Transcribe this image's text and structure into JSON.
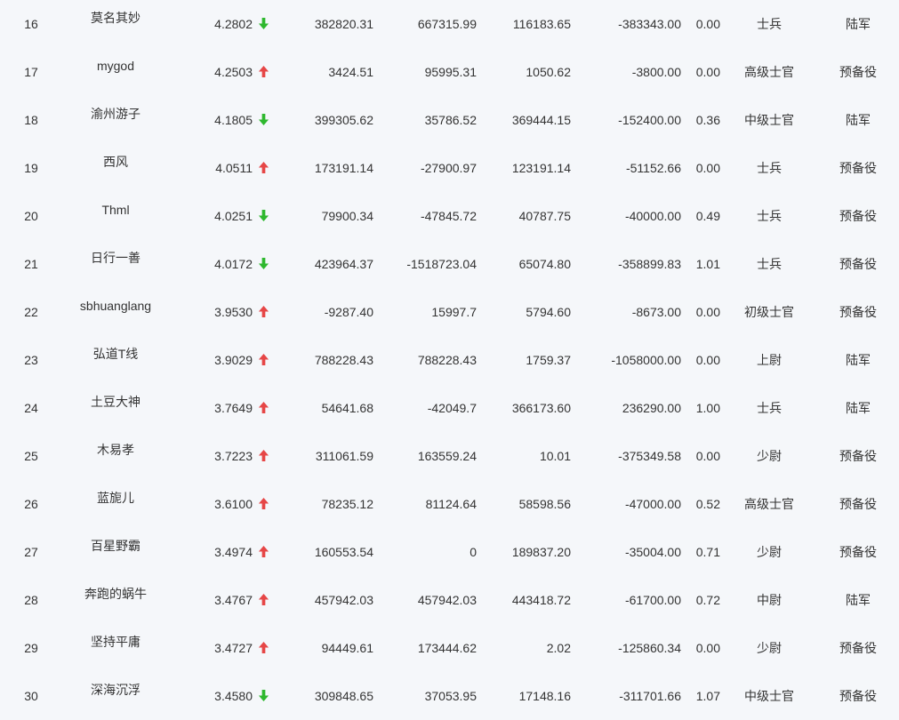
{
  "colors": {
    "background": "#f5f7fa",
    "text": "#333333",
    "up": "#e64646",
    "down": "#2eb82e"
  },
  "rows": [
    {
      "rank": "16",
      "name": "莫名其妙",
      "score": "4.2802",
      "trend": "down",
      "v1": "382820.31",
      "v2": "667315.99",
      "v3": "116183.65",
      "v4": "-383343.00",
      "v5": "0.00",
      "title": "士兵",
      "branch": "陆军"
    },
    {
      "rank": "17",
      "name": "mygod",
      "score": "4.2503",
      "trend": "up",
      "v1": "3424.51",
      "v2": "95995.31",
      "v3": "1050.62",
      "v4": "-3800.00",
      "v5": "0.00",
      "title": "高级士官",
      "branch": "预备役"
    },
    {
      "rank": "18",
      "name": "渝州游子",
      "score": "4.1805",
      "trend": "down",
      "v1": "399305.62",
      "v2": "35786.52",
      "v3": "369444.15",
      "v4": "-152400.00",
      "v5": "0.36",
      "title": "中级士官",
      "branch": "陆军"
    },
    {
      "rank": "19",
      "name": "西风",
      "score": "4.0511",
      "trend": "up",
      "v1": "173191.14",
      "v2": "-27900.97",
      "v3": "123191.14",
      "v4": "-51152.66",
      "v5": "0.00",
      "title": "士兵",
      "branch": "预备役"
    },
    {
      "rank": "20",
      "name": "Thml",
      "score": "4.0251",
      "trend": "down",
      "v1": "79900.34",
      "v2": "-47845.72",
      "v3": "40787.75",
      "v4": "-40000.00",
      "v5": "0.49",
      "title": "士兵",
      "branch": "预备役"
    },
    {
      "rank": "21",
      "name": "日行一善",
      "score": "4.0172",
      "trend": "down",
      "v1": "423964.37",
      "v2": "-1518723.04",
      "v3": "65074.80",
      "v4": "-358899.83",
      "v5": "1.01",
      "title": "士兵",
      "branch": "预备役"
    },
    {
      "rank": "22",
      "name": "sbhuanglang",
      "score": "3.9530",
      "trend": "up",
      "v1": "-9287.40",
      "v2": "15997.7",
      "v3": "5794.60",
      "v4": "-8673.00",
      "v5": "0.00",
      "title": "初级士官",
      "branch": "预备役"
    },
    {
      "rank": "23",
      "name": "弘道T线",
      "score": "3.9029",
      "trend": "up",
      "v1": "788228.43",
      "v2": "788228.43",
      "v3": "1759.37",
      "v4": "-1058000.00",
      "v5": "0.00",
      "title": "上尉",
      "branch": "陆军"
    },
    {
      "rank": "24",
      "name": "土豆大神",
      "score": "3.7649",
      "trend": "up",
      "v1": "54641.68",
      "v2": "-42049.7",
      "v3": "366173.60",
      "v4": "236290.00",
      "v5": "1.00",
      "title": "士兵",
      "branch": "陆军"
    },
    {
      "rank": "25",
      "name": "木易孝",
      "score": "3.7223",
      "trend": "up",
      "v1": "311061.59",
      "v2": "163559.24",
      "v3": "10.01",
      "v4": "-375349.58",
      "v5": "0.00",
      "title": "少尉",
      "branch": "预备役"
    },
    {
      "rank": "26",
      "name": "蓝旎儿",
      "score": "3.6100",
      "trend": "up",
      "v1": "78235.12",
      "v2": "81124.64",
      "v3": "58598.56",
      "v4": "-47000.00",
      "v5": "0.52",
      "title": "高级士官",
      "branch": "预备役"
    },
    {
      "rank": "27",
      "name": "百星野霸",
      "score": "3.4974",
      "trend": "up",
      "v1": "160553.54",
      "v2": "0",
      "v3": "189837.20",
      "v4": "-35004.00",
      "v5": "0.71",
      "title": "少尉",
      "branch": "预备役"
    },
    {
      "rank": "28",
      "name": "奔跑的蜗牛",
      "score": "3.4767",
      "trend": "up",
      "v1": "457942.03",
      "v2": "457942.03",
      "v3": "443418.72",
      "v4": "-61700.00",
      "v5": "0.72",
      "title": "中尉",
      "branch": "陆军"
    },
    {
      "rank": "29",
      "name": "坚持平庸",
      "score": "3.4727",
      "trend": "up",
      "v1": "94449.61",
      "v2": "173444.62",
      "v3": "2.02",
      "v4": "-125860.34",
      "v5": "0.00",
      "title": "少尉",
      "branch": "预备役"
    },
    {
      "rank": "30",
      "name": "深海沉浮",
      "score": "3.4580",
      "trend": "down",
      "v1": "309848.65",
      "v2": "37053.95",
      "v3": "17148.16",
      "v4": "-311701.66",
      "v5": "1.07",
      "title": "中级士官",
      "branch": "预备役"
    }
  ]
}
